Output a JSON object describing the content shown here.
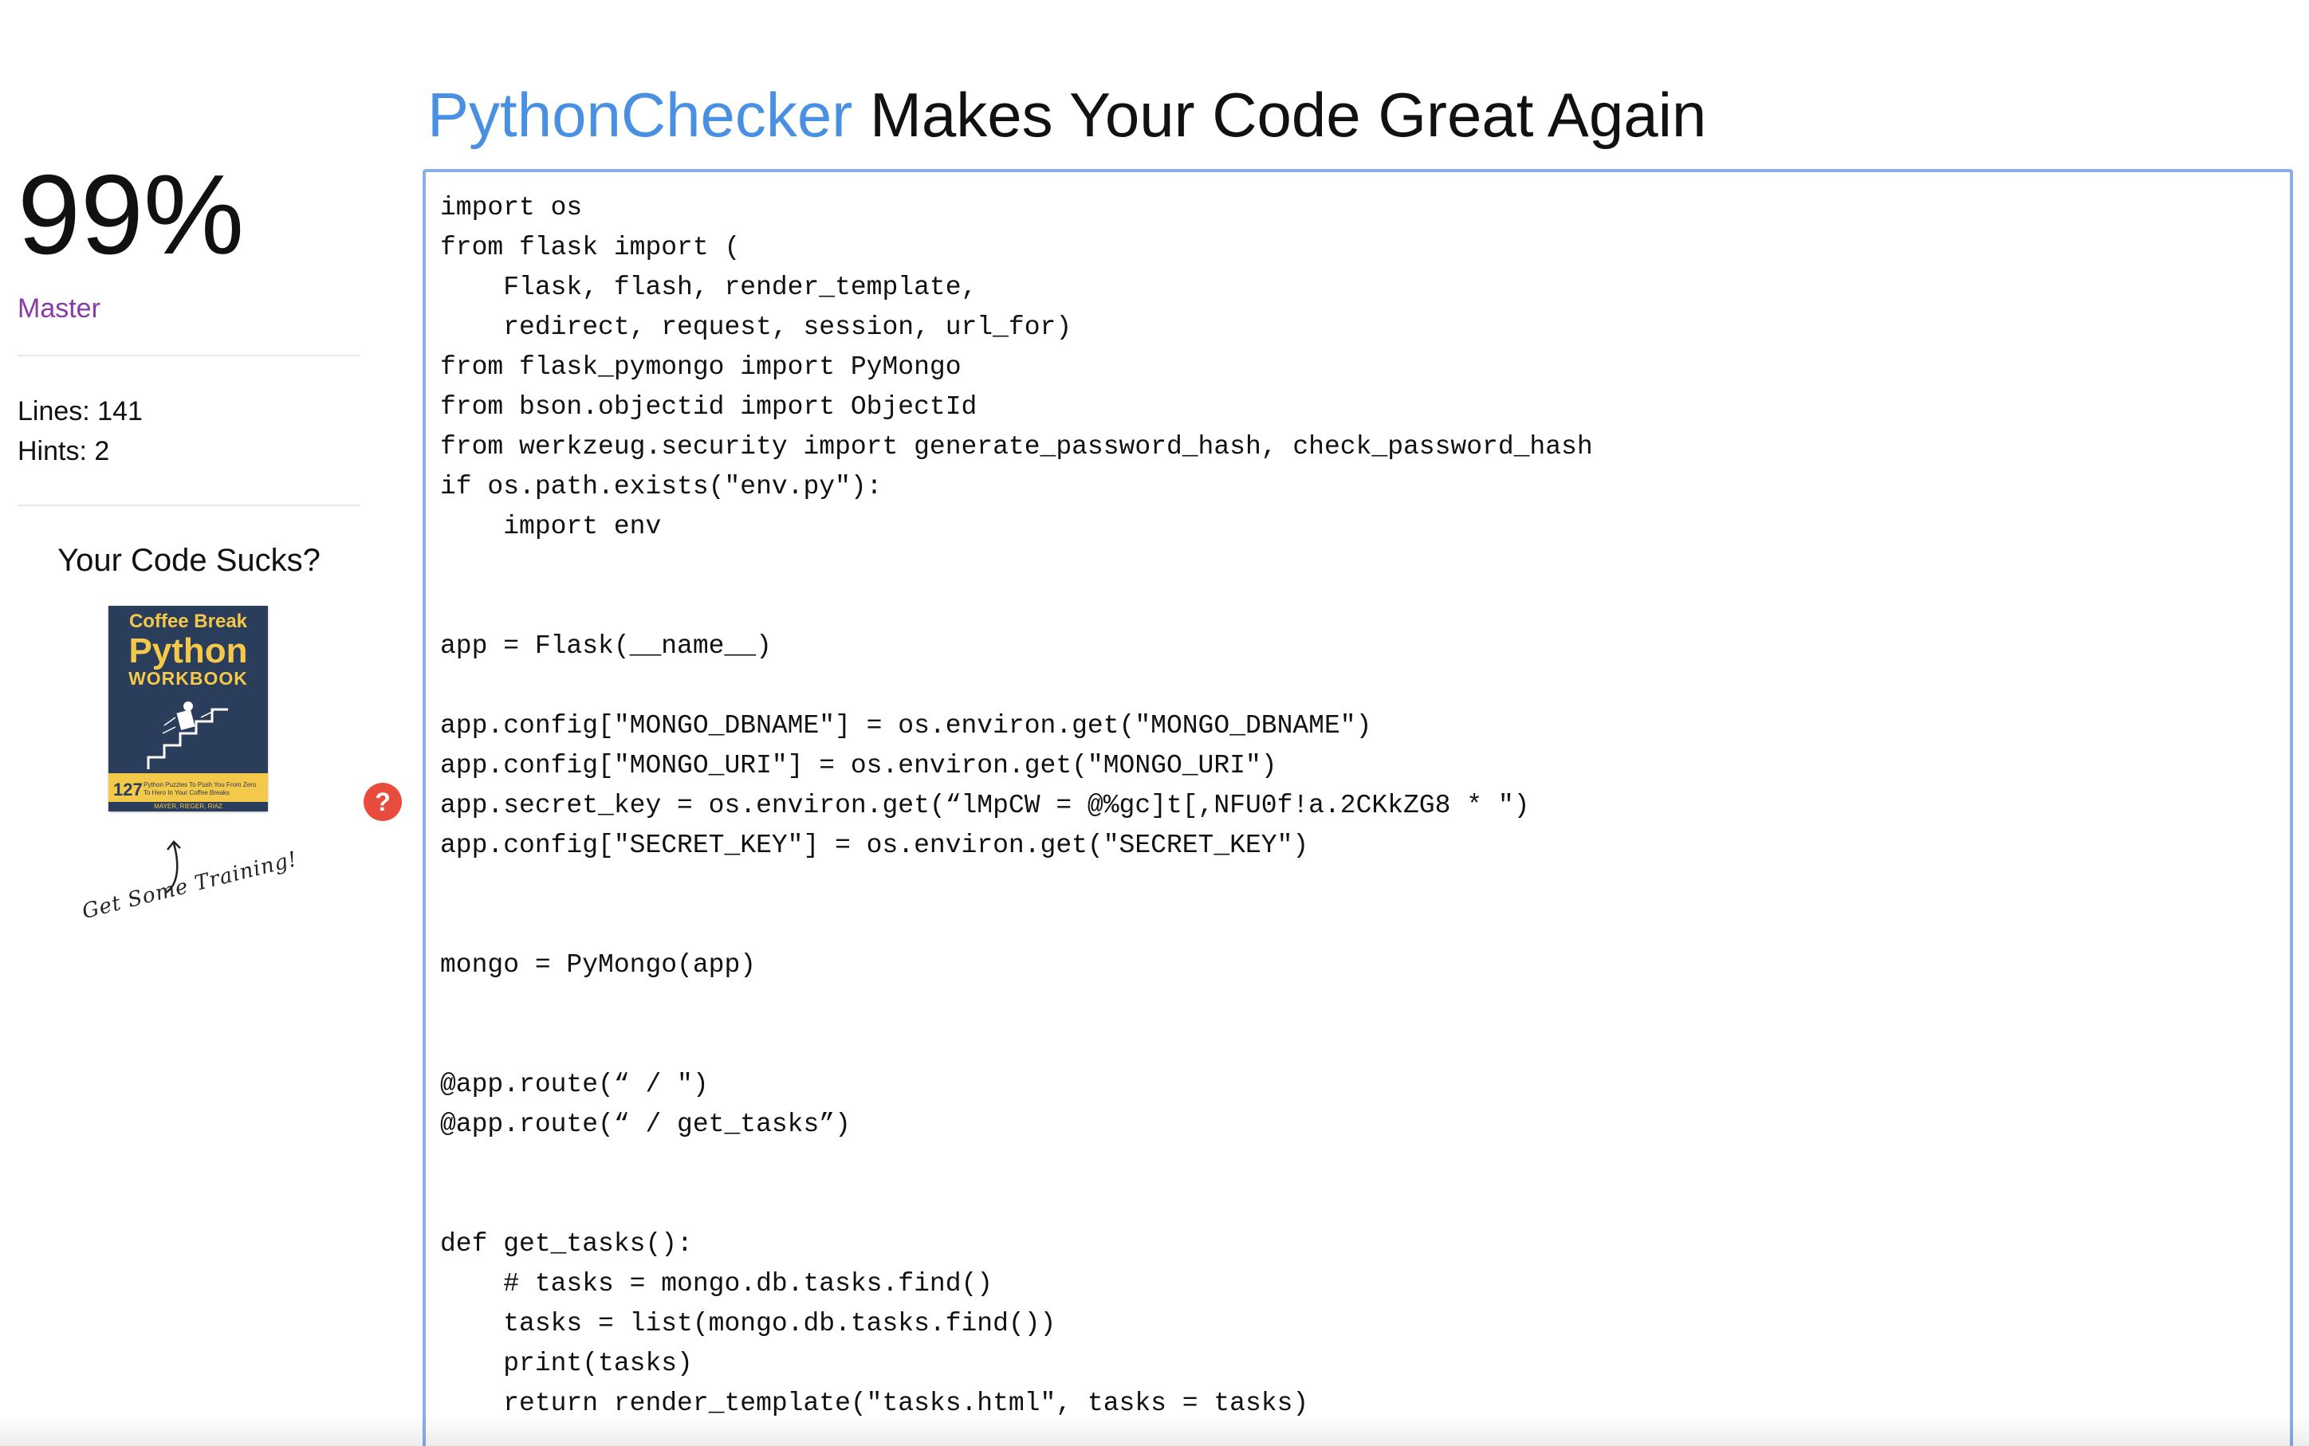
{
  "header": {
    "brand": "PythonChecker",
    "tagline": " Makes Your Code Great Again"
  },
  "sidebar": {
    "score": "99%",
    "rank": "Master",
    "lines": "Lines: 141",
    "hints": "Hints: 2",
    "promo_heading": "Your Code Sucks?",
    "book": {
      "line1": "Coffee Break",
      "line2": "Python",
      "line3": "WORKBOOK",
      "count": "127",
      "blurb": "Python Puzzles To Push You From Zero To Hero In Your Coffee Breaks",
      "authors": "MAYER, RIEGER, RIAZ"
    },
    "training_note": "Get Some Training!"
  },
  "hint_badge": "?",
  "colors": {
    "brand": "#4a90e2",
    "rank": "#8a3aa8",
    "hint_badge": "#e74c3c",
    "editor_border": "#8aaee5"
  },
  "editor": {
    "code": "import os\nfrom flask import (\n    Flask, flash, render_template,\n    redirect, request, session, url_for)\nfrom flask_pymongo import PyMongo\nfrom bson.objectid import ObjectId\nfrom werkzeug.security import generate_password_hash, check_password_hash\nif os.path.exists(\"env.py\"):\n    import env\n\n\napp = Flask(__name__)\n\napp.config[\"MONGO_DBNAME\"] = os.environ.get(\"MONGO_DBNAME\")\napp.config[\"MONGO_URI\"] = os.environ.get(\"MONGO_URI\")\napp.secret_key = os.environ.get(“lMpCW = @%gc]t[,NFU0f!a.2CKkZG8 * \")\napp.config[\"SECRET_KEY\"] = os.environ.get(\"SECRET_KEY\")\n\n\nmongo = PyMongo(app)\n\n\n@app.route(“ / \")\n@app.route(“ / get_tasks”)\n\n\ndef get_tasks():\n    # tasks = mongo.db.tasks.find()\n    tasks = list(mongo.db.tasks.find())\n    print(tasks)\n    return render_template(\"tasks.html\", tasks = tasks)"
  }
}
